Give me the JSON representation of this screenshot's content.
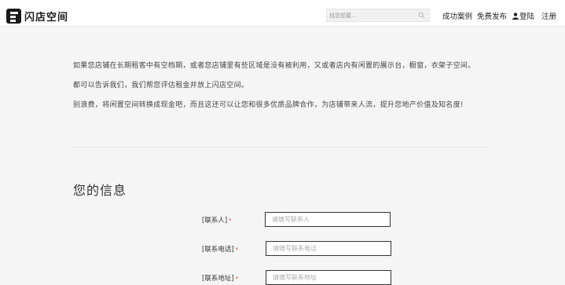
{
  "header": {
    "logo_text": "闪店空间",
    "search_placeholder": "找您想要...",
    "nav": {
      "success_cases": "成功案例",
      "free_publish": "免费发布",
      "login": "登陆",
      "register": "注册"
    }
  },
  "intro": {
    "line1": "如果您店铺在长期租客中有空档期，或者您店铺里有些区域是没有被利用，又或者店内有闲置的展示台，橱窗，衣架子空间。",
    "line2": "都可以告诉我们，我们帮您评估租金并放上闪店空间。",
    "line3": "别浪费，将闲置空间转换成现金吧，而且这还可以让您和很多优质品牌合作，为店铺带来人流，提升您地产价值及知名度!"
  },
  "form": {
    "title": "您的信息",
    "required_mark": "*",
    "fields": [
      {
        "label": "[联系人]",
        "placeholder": "请填写联系人"
      },
      {
        "label": "[联系电话]",
        "placeholder": "请填写联系电话"
      },
      {
        "label": "[联系地址]",
        "placeholder": "请填写联系地址"
      }
    ]
  }
}
